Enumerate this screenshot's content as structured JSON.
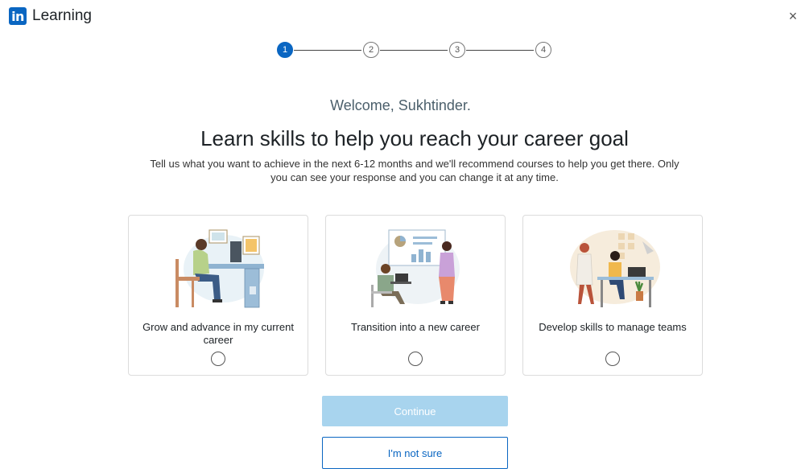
{
  "app": {
    "logo_mark": "in",
    "logo_name": "Learning",
    "close_label": "×"
  },
  "stepper": {
    "steps": [
      "1",
      "2",
      "3",
      "4"
    ],
    "current": 1
  },
  "welcome": "Welcome, Sukhtinder.",
  "headline": "Learn skills to help you reach your career goal",
  "subtext": "Tell us what you want to achieve in the next 6-12 months and we'll recommend courses to help you get there. Only you can see your response and you can change it at any time.",
  "options": [
    {
      "label": "Grow and advance in my current career",
      "illustration": "person-at-desk-illustration",
      "selected": false
    },
    {
      "label": "Transition into a new career",
      "illustration": "presentation-illustration",
      "selected": false
    },
    {
      "label": "Develop skills to manage teams",
      "illustration": "team-meeting-illustration",
      "selected": false
    }
  ],
  "buttons": {
    "continue": "Continue",
    "not_sure": "I'm not sure"
  },
  "colors": {
    "brand": "#0a66c2",
    "continue_disabled": "#a8d4ee"
  }
}
